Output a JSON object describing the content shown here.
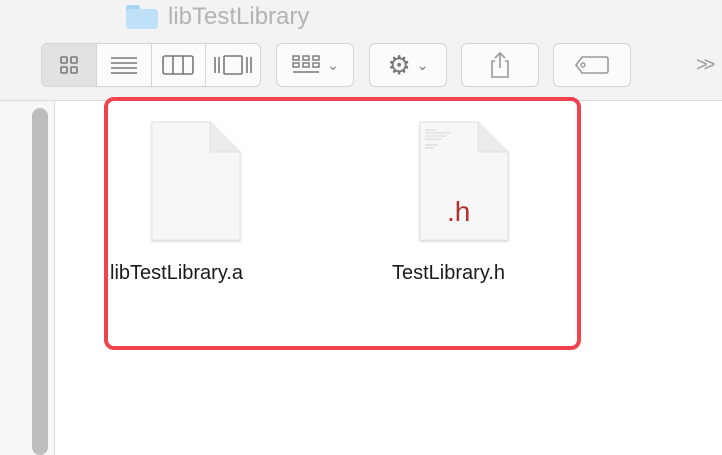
{
  "window": {
    "title": "libTestLibrary"
  },
  "toolbar": {
    "view_modes": [
      "icon-view",
      "list-view",
      "column-view",
      "cover-flow-view"
    ],
    "more_glyph": ">>"
  },
  "files": [
    {
      "name": "libTestLibrary.a",
      "icon": "blank-document-icon"
    },
    {
      "name": "TestLibrary.h",
      "icon": "header-document-icon",
      "badge": ".h"
    }
  ],
  "colors": {
    "selection_outline": "#f0434e",
    "h_badge": "#b0312d",
    "folder": "#bfe1f7"
  }
}
